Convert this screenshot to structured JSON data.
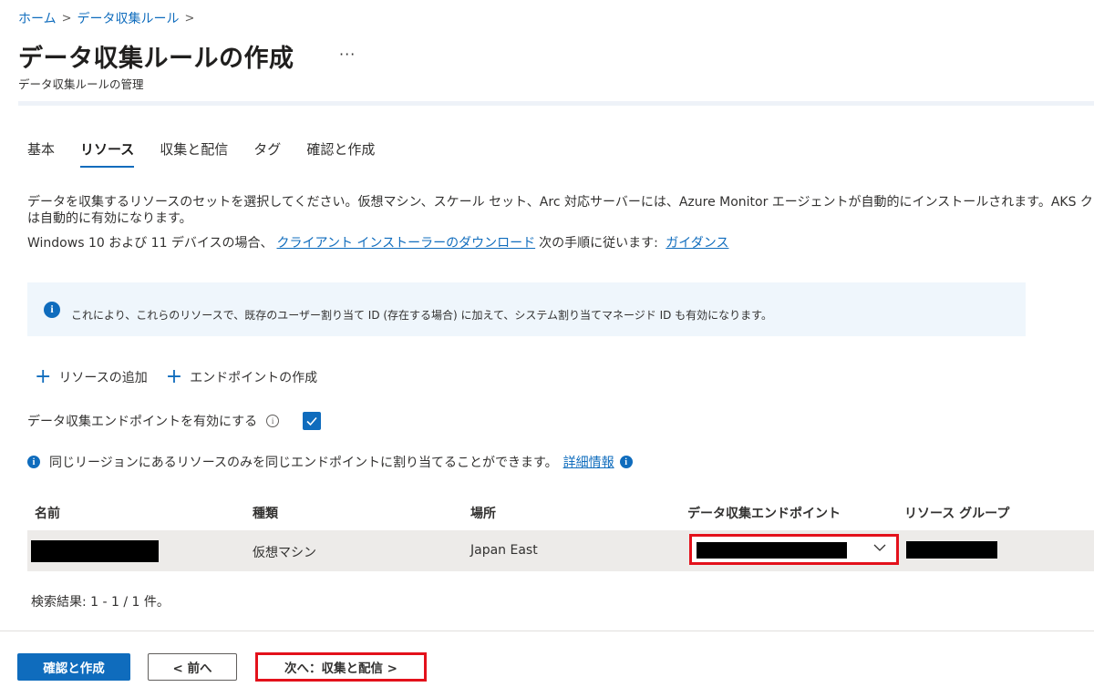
{
  "breadcrumb": {
    "home": "ホーム",
    "dcr": "データ収集ルール",
    "separator": ">"
  },
  "page": {
    "title": "データ収集ルールの作成",
    "more": "···",
    "subtitle": "データ収集ルールの管理"
  },
  "tabs": [
    {
      "label": "基本",
      "active": false
    },
    {
      "label": "リソース",
      "active": true
    },
    {
      "label": "収集と配信",
      "active": false
    },
    {
      "label": "タグ",
      "active": false
    },
    {
      "label": "確認と作成",
      "active": false
    }
  ],
  "description": {
    "line1": "データを収集するリソースのセットを選択してください。仮想マシン、スケール セット、Arc 対応サーバーには、Azure Monitor エージェントが自動的にインストールされます。AKS ク",
    "line2": "は自動的に有効になります。",
    "line3_prefix": "Windows 10 および 11 デバイスの場合、",
    "line3_link": "クライアント インストーラーのダウンロード",
    "line3_middle": "次の手順に従います:",
    "line3_link2": "ガイダンス"
  },
  "info_banner": {
    "text": "これにより、これらのリソースで、既存のユーザー割り当て ID (存在する場合) に加えて、システム割り当てマネージド ID も有効になります。"
  },
  "actions": {
    "add_resource": "リソースの追加",
    "create_endpoint": "エンドポイントの作成"
  },
  "enable_endpoint": {
    "label": "データ収集エンドポイントを有効にする",
    "checked": true
  },
  "note": {
    "text": "同じリージョンにあるリソースのみを同じエンドポイントに割り当てることができます。",
    "link": "詳細情報"
  },
  "table": {
    "columns": [
      "名前",
      "種類",
      "場所",
      "データ収集エンドポイント",
      "リソース グループ"
    ],
    "rows": [
      {
        "type": "仮想マシン",
        "location": "Japan East"
      }
    ]
  },
  "results": "検索結果: 1 - 1 / 1 件。",
  "footer": {
    "review_create": "確認と作成",
    "prev": "< 前へ",
    "next": "次へ：収集と配信 >"
  },
  "colors": {
    "accent": "#0f6cbd",
    "highlight": "#e3111b",
    "info_bg": "#eff6fc",
    "row_bg": "#edebe9"
  }
}
